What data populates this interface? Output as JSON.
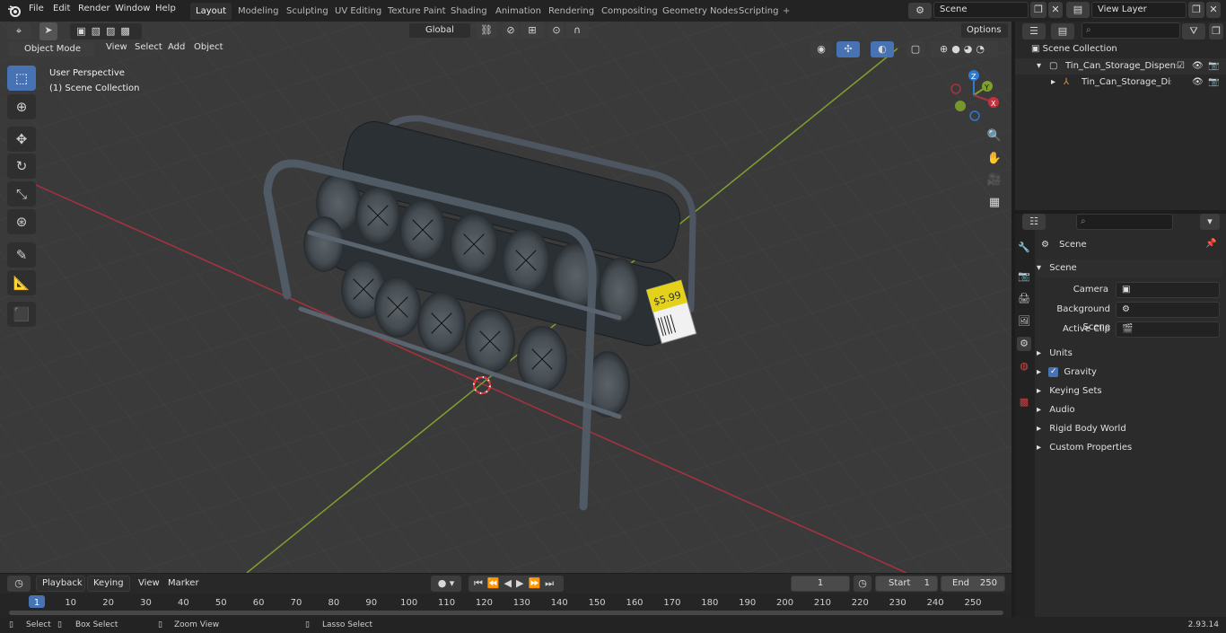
{
  "topbar": {
    "menus": [
      "File",
      "Edit",
      "Render",
      "Window",
      "Help"
    ],
    "workspaces": [
      "Layout",
      "Modeling",
      "Sculpting",
      "UV Editing",
      "Texture Paint",
      "Shading",
      "Animation",
      "Rendering",
      "Compositing",
      "Geometry Nodes",
      "Scripting"
    ],
    "active_workspace": "Layout",
    "add_tab": "+",
    "scene_name": "Scene",
    "view_layer": "View Layer"
  },
  "viewport_header": {
    "mode": "Object Mode",
    "menus": [
      "View",
      "Select",
      "Add",
      "Object"
    ],
    "orientation": "Global",
    "options": "Options"
  },
  "viewport": {
    "perspective": "User Perspective",
    "collection": "(1) Scene Collection",
    "price_tag": "$5.99",
    "gizmo": {
      "z": "Z",
      "y": "Y",
      "x": "X"
    }
  },
  "outliner": {
    "root": "Scene Collection",
    "items": [
      {
        "label": "Tin_Can_Storage_Dispenser_v",
        "level": 1
      },
      {
        "label": "Tin_Can_Storage_Dispen",
        "level": 2
      }
    ]
  },
  "properties": {
    "title": "Scene",
    "section": "Scene",
    "fields": [
      {
        "label": "Camera",
        "value": ""
      },
      {
        "label": "Background Scene",
        "value": ""
      },
      {
        "label": "Active Clip",
        "value": ""
      }
    ],
    "panels": [
      "Units",
      "Gravity",
      "Keying Sets",
      "Audio",
      "Rigid Body World",
      "Custom Properties"
    ],
    "gravity_checked": true
  },
  "timeline": {
    "menus": [
      "Playback",
      "Keying",
      "View",
      "Marker"
    ],
    "current_frame": "1",
    "start_label": "Start",
    "start": "1",
    "end_label": "End",
    "end": "250",
    "ticks": [
      "1",
      "10",
      "20",
      "30",
      "40",
      "50",
      "60",
      "70",
      "80",
      "90",
      "100",
      "110",
      "120",
      "130",
      "140",
      "150",
      "160",
      "170",
      "180",
      "190",
      "200",
      "210",
      "220",
      "230",
      "240",
      "250"
    ]
  },
  "statusbar": {
    "items": [
      "Select",
      "Box Select",
      "Zoom View",
      "Lasso Select"
    ],
    "version": "2.93.14"
  },
  "colors": {
    "accent": "#4772b3",
    "x_axis": "#a8323f",
    "y_axis": "#7ea12e",
    "z_axis": "#2e79d2"
  }
}
